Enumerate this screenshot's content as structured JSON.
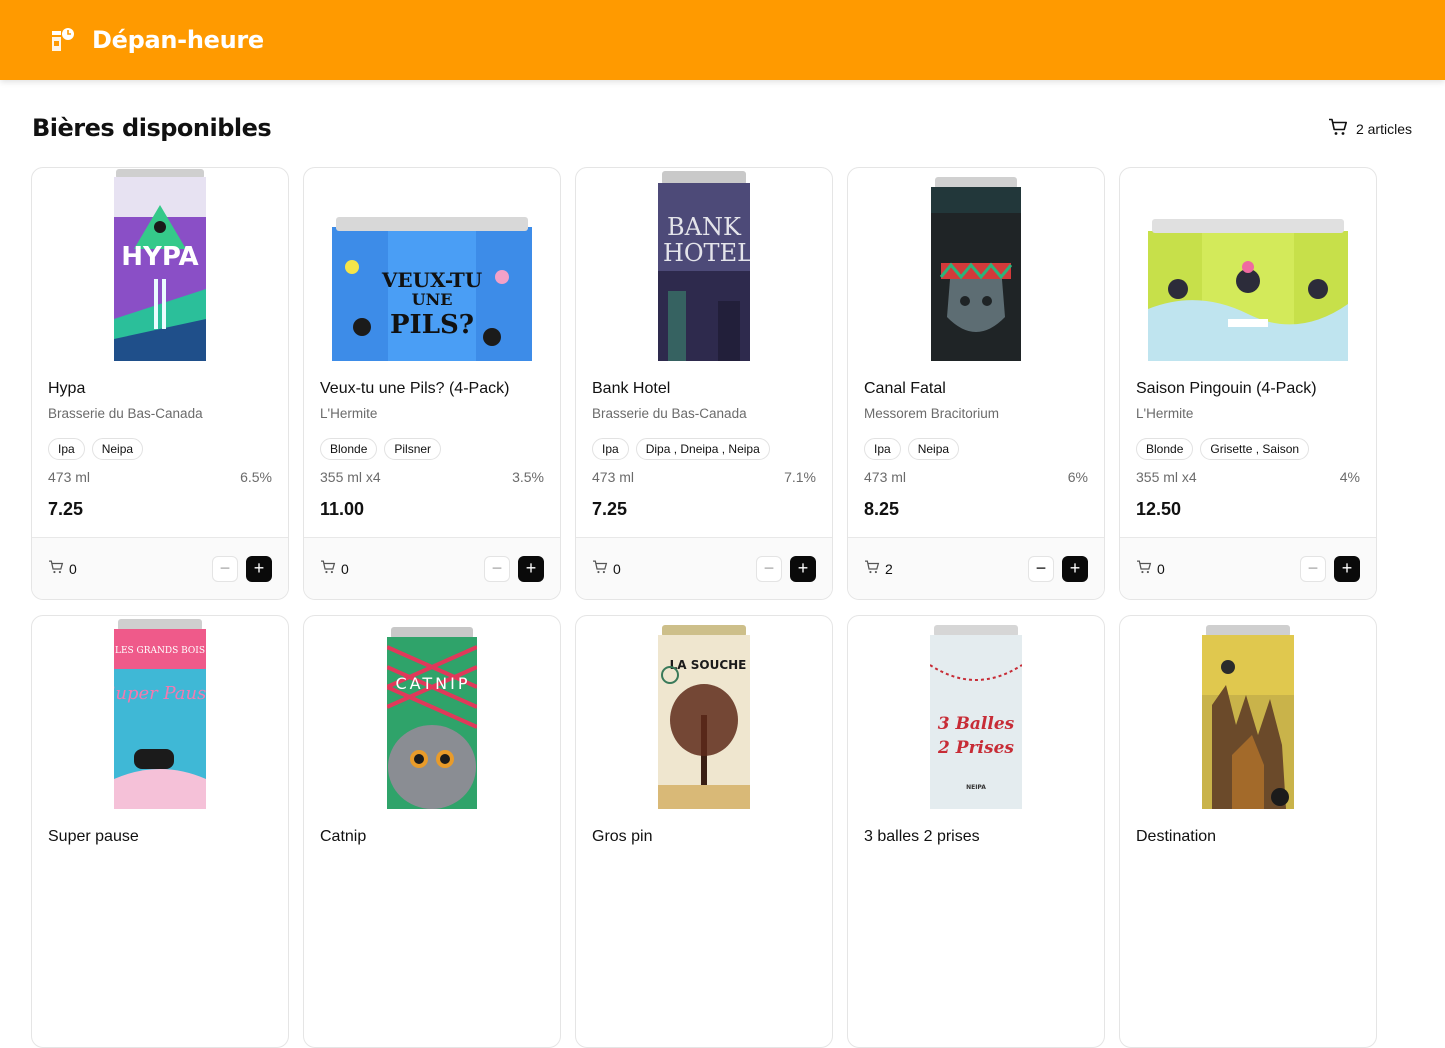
{
  "header": {
    "app_title": "Dépan-heure"
  },
  "page": {
    "title": "Bières disponibles"
  },
  "cart": {
    "label": "2 articles"
  },
  "products": [
    {
      "name": "Hypa",
      "brewery": "Brasserie du Bas-Canada",
      "tags": [
        "Ipa",
        "Neipa"
      ],
      "volume": "473 ml",
      "abv": "6.5%",
      "price": "7.25",
      "qty": "0"
    },
    {
      "name": "Veux-tu une Pils? (4-Pack)",
      "brewery": "L'Hermite",
      "tags": [
        "Blonde",
        "Pilsner"
      ],
      "volume": "355 ml x4",
      "abv": "3.5%",
      "price": "11.00",
      "qty": "0"
    },
    {
      "name": "Bank Hotel",
      "brewery": "Brasserie du Bas-Canada",
      "tags": [
        "Ipa",
        "Dipa , Dneipa , Neipa"
      ],
      "volume": "473 ml",
      "abv": "7.1%",
      "price": "7.25",
      "qty": "0"
    },
    {
      "name": "Canal Fatal",
      "brewery": "Messorem Bracitorium",
      "tags": [
        "Ipa",
        "Neipa"
      ],
      "volume": "473 ml",
      "abv": "6%",
      "price": "8.25",
      "qty": "2"
    },
    {
      "name": "Saison Pingouin (4-Pack)",
      "brewery": "L'Hermite",
      "tags": [
        "Blonde",
        "Grisette , Saison"
      ],
      "volume": "355 ml x4",
      "abv": "4%",
      "price": "12.50",
      "qty": "0"
    },
    {
      "name": "Super pause"
    },
    {
      "name": "Catnip"
    },
    {
      "name": "Gros pin"
    },
    {
      "name": "3 balles 2 prises"
    },
    {
      "name": "Destination"
    }
  ],
  "can_text": {
    "hypa": "HYPA",
    "pils_line1": "VEUX-TU",
    "pils_line2": "UNE",
    "pils_line3": "PILS?",
    "bank_line1": "BANK",
    "bank_line2": "HOTEL",
    "superpause_brand": "LES GRANDS BOIS",
    "superpause_script": "Super Pause",
    "catnip": "CATNIP",
    "souche": "LA SOUCHE",
    "balles_line1": "3 Balles",
    "balles_line2": "2 Prises",
    "balles_style": "NEIPA"
  },
  "colors": {
    "brand": "#ff9a00",
    "plus_button": "#0a0a0a"
  },
  "icons": {
    "cart": "cart-icon",
    "minus": "minus-icon",
    "plus": "plus-icon",
    "logo": "clock-store-logo"
  }
}
